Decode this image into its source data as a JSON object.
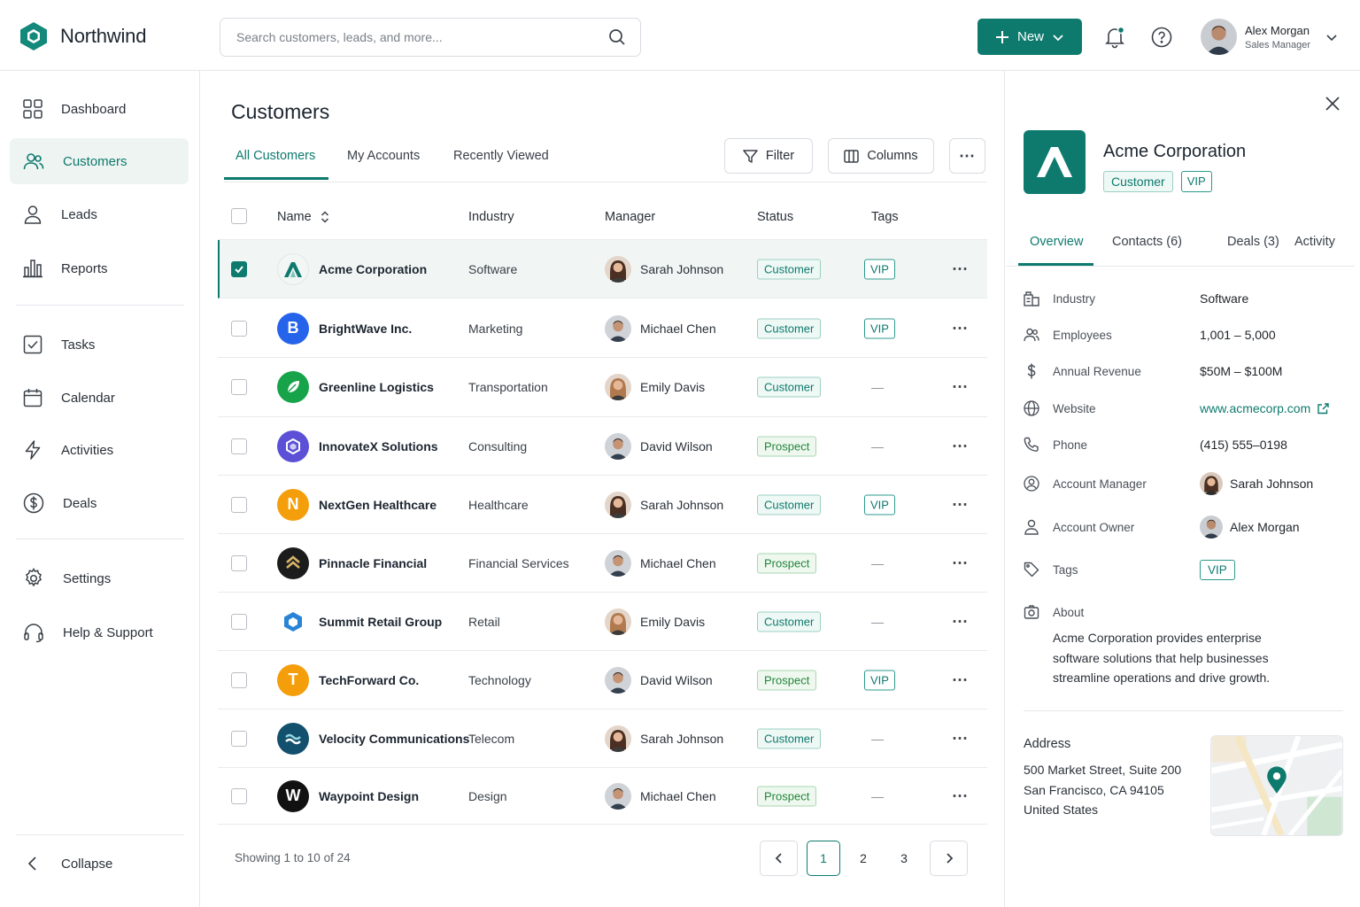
{
  "app": {
    "name": "Northwind"
  },
  "search": {
    "placeholder": "Search customers, leads, and more..."
  },
  "header": {
    "new_label": "New"
  },
  "user": {
    "name": "Alex Morgan",
    "role": "Sales Manager"
  },
  "sidebar": {
    "items": [
      {
        "label": "Dashboard"
      },
      {
        "label": "Customers"
      },
      {
        "label": "Leads"
      },
      {
        "label": "Reports"
      },
      {
        "label": "Tasks"
      },
      {
        "label": "Calendar"
      },
      {
        "label": "Activities"
      },
      {
        "label": "Deals"
      },
      {
        "label": "Settings"
      },
      {
        "label": "Help & Support"
      }
    ],
    "collapse_label": "Collapse"
  },
  "main": {
    "title": "Customers",
    "tabs": [
      {
        "label": "All Customers"
      },
      {
        "label": "My Accounts"
      },
      {
        "label": "Recently Viewed"
      }
    ],
    "filter_label": "Filter",
    "columns_label": "Columns",
    "table": {
      "headers": {
        "name": "Name",
        "industry": "Industry",
        "manager": "Manager",
        "status": "Status",
        "tags": "Tags"
      },
      "rows": [
        {
          "name": "Acme Corporation",
          "industry": "Software",
          "manager": "Sarah Johnson",
          "status": "Customer",
          "tag": "VIP"
        },
        {
          "name": "BrightWave Inc.",
          "industry": "Marketing",
          "manager": "Michael Chen",
          "status": "Customer",
          "tag": "VIP"
        },
        {
          "name": "Greenline Logistics",
          "industry": "Transportation",
          "manager": "Emily Davis",
          "status": "Customer",
          "tag": "—"
        },
        {
          "name": "InnovateX Solutions",
          "industry": "Consulting",
          "manager": "David Wilson",
          "status": "Prospect",
          "tag": "—"
        },
        {
          "name": "NextGen Healthcare",
          "industry": "Healthcare",
          "manager": "Sarah Johnson",
          "status": "Customer",
          "tag": "VIP"
        },
        {
          "name": "Pinnacle Financial",
          "industry": "Financial Services",
          "manager": "Michael Chen",
          "status": "Prospect",
          "tag": "—"
        },
        {
          "name": "Summit Retail Group",
          "industry": "Retail",
          "manager": "Emily Davis",
          "status": "Customer",
          "tag": "—"
        },
        {
          "name": "TechForward Co.",
          "industry": "Technology",
          "manager": "David Wilson",
          "status": "Prospect",
          "tag": "VIP"
        },
        {
          "name": "Velocity Communications",
          "industry": "Telecom",
          "manager": "Sarah Johnson",
          "status": "Customer",
          "tag": "—"
        },
        {
          "name": "Waypoint Design",
          "industry": "Design",
          "manager": "Michael Chen",
          "status": "Prospect",
          "tag": "—"
        }
      ]
    },
    "footer": {
      "showing": "Showing 1 to 10 of 24",
      "pages": [
        "1",
        "2",
        "3"
      ],
      "current_page": "1"
    }
  },
  "detail": {
    "company": "Acme Corporation",
    "badges": [
      "Customer",
      "VIP"
    ],
    "tabs": [
      {
        "label": "Overview"
      },
      {
        "label": "Contacts (6)"
      },
      {
        "label": "Deals (3)"
      },
      {
        "label": "Activity"
      }
    ],
    "fields": [
      {
        "label": "Industry",
        "value": "Software"
      },
      {
        "label": "Employees",
        "value": "1,001 – 5,000"
      },
      {
        "label": "Annual Revenue",
        "value": "$50M – $100M"
      },
      {
        "label": "Website",
        "value": "www.acmecorp.com"
      },
      {
        "label": "Phone",
        "value": "(415) 555–0198"
      },
      {
        "label": "Account Manager",
        "value": "Sarah Johnson"
      },
      {
        "label": "Account Owner",
        "value": "Alex Morgan"
      },
      {
        "label": "Tags",
        "value": "VIP"
      }
    ],
    "about_label": "About",
    "about_text": "Acme Corporation provides enterprise software solutions that help businesses streamline operations and drive growth.",
    "address_label": "Address",
    "address_lines": [
      "500 Market Street, Suite 200",
      "San Francisco, CA 94105",
      "United States"
    ]
  },
  "colors": {
    "accent": "#0e7a6e",
    "prospect": "#23853b"
  }
}
